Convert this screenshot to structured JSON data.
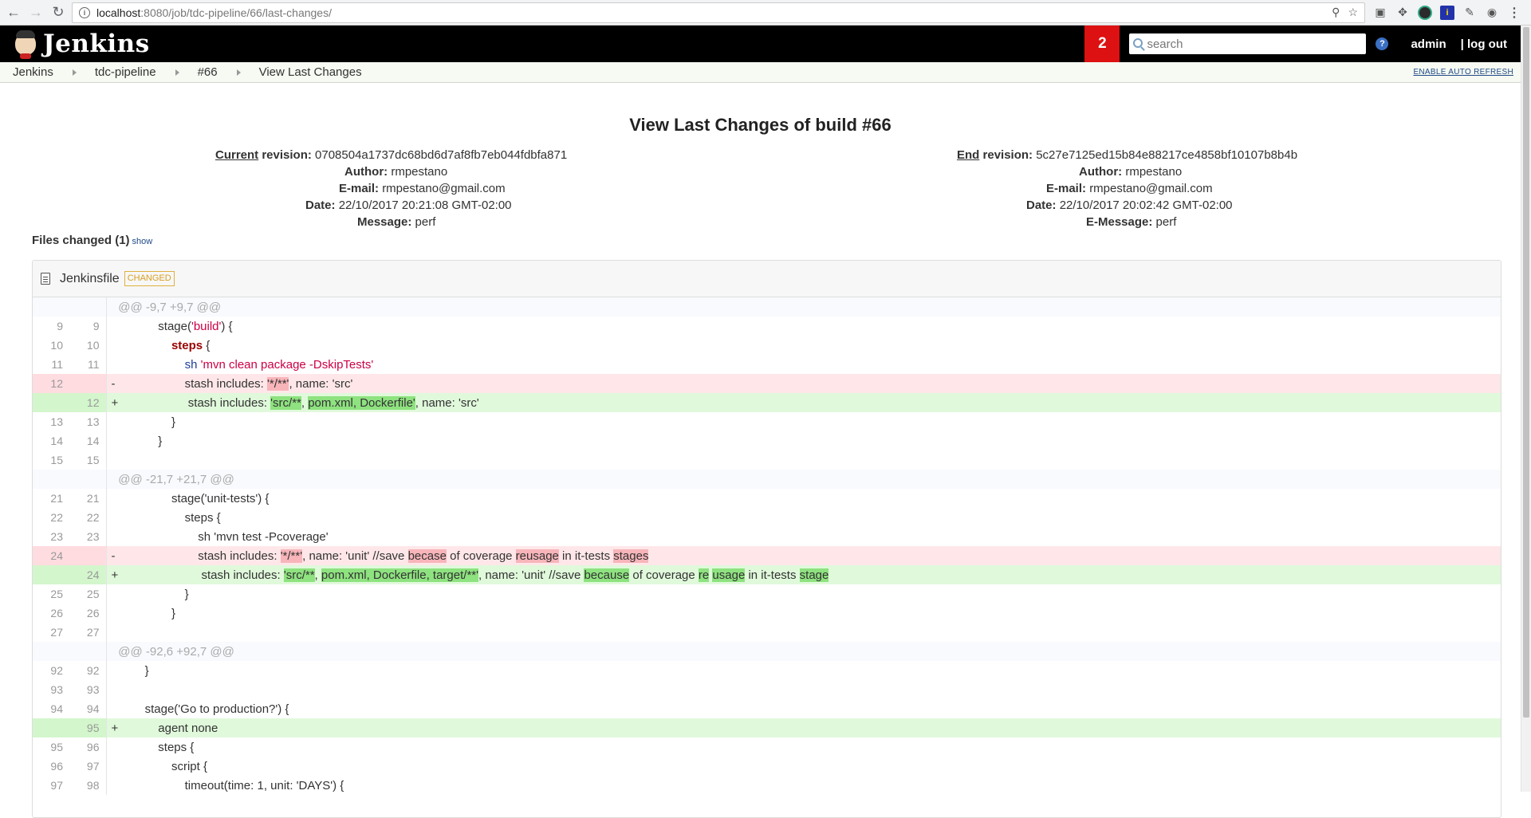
{
  "browser": {
    "url_host": "localhost",
    "url_rest": ":8080/job/tdc-pipeline/66/last-changes/"
  },
  "header": {
    "logo_text": "Jenkins",
    "notification_count": "2",
    "search_placeholder": "search",
    "help": "?",
    "user": "admin",
    "logout": "| log out"
  },
  "breadcrumbs": [
    "Jenkins",
    "tdc-pipeline",
    "#66",
    "View Last Changes"
  ],
  "auto_refresh": "ENABLE AUTO REFRESH",
  "page_title": "View Last Changes of build #66",
  "current": {
    "label_u": "Current",
    "label_rest": " revision:",
    "revision": "0708504a1737dc68bd6d7af8fb7eb044fdbfa871",
    "author_label": "Author:",
    "author": "rmpestano",
    "email_label": "E-mail:",
    "email": "rmpestano@gmail.com",
    "date_label": "Date:",
    "date": "22/10/2017 20:21:08 GMT-02:00",
    "message_label": "Message:",
    "message": "perf"
  },
  "end": {
    "label_u": "End",
    "label_rest": " revision:",
    "revision": "5c27e7125ed15b84e88217ce4858bf10107b8b4b",
    "author_label": "Author:",
    "author": "rmpestano",
    "email_label": "E-mail:",
    "email": "rmpestano@gmail.com",
    "date_label": "Date:",
    "date": "22/10/2017 20:02:42 GMT-02:00",
    "message_label": "E-Message:",
    "message": "perf"
  },
  "files_changed": {
    "label": "Files changed (1)",
    "show": "show"
  },
  "file": {
    "name": "Jenkinsfile",
    "badge": "CHANGED"
  }
}
